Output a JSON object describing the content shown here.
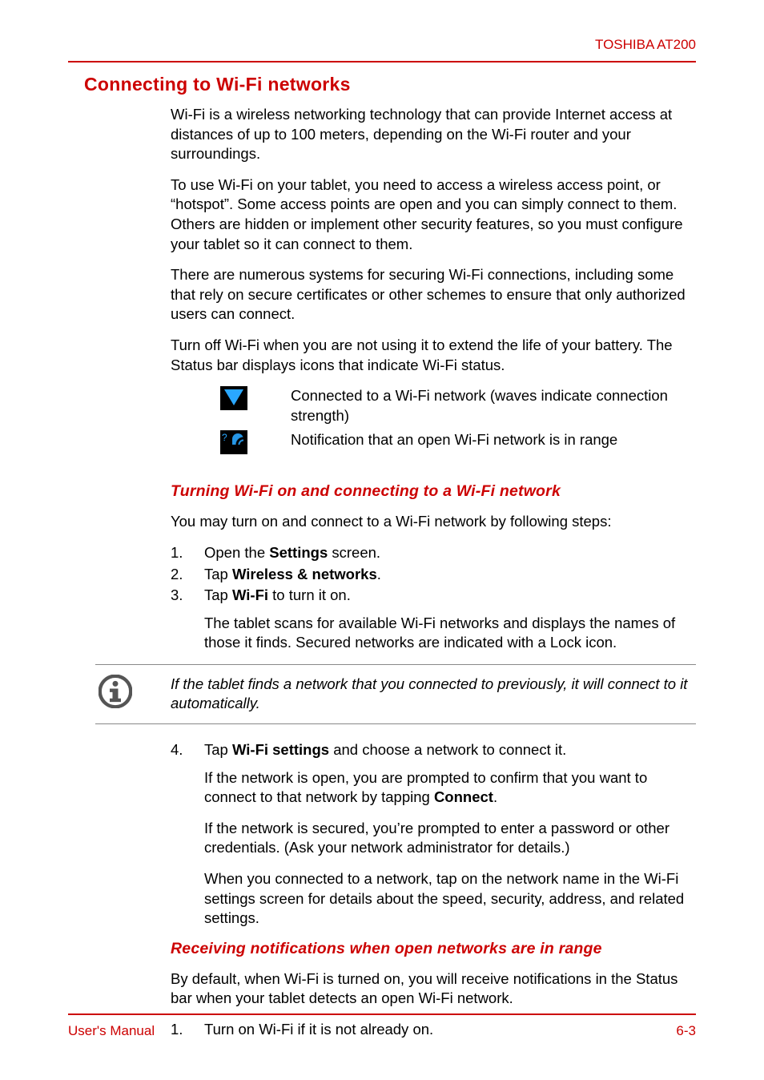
{
  "header": {
    "brand": "TOSHIBA AT200"
  },
  "section": {
    "title": "Connecting to Wi-Fi networks",
    "paras": [
      "Wi-Fi is a wireless networking technology that can provide Internet access at distances of up to 100 meters, depending on the Wi-Fi router and your surroundings.",
      "To use Wi-Fi on your tablet, you need to access a wireless access point, or “hotspot”. Some access points are open and you can simply connect to them. Others are hidden or implement other security features, so you must configure your tablet so it can connect to them.",
      "There are numerous systems for securing Wi-Fi connections, including some that rely on secure certificates or other schemes to ensure that only authorized users can connect.",
      "Turn off Wi-Fi when you are not using it to extend the life of your battery. The Status bar displays icons that indicate Wi-Fi status."
    ],
    "status_icons": [
      {
        "name": "wifi-connected-icon",
        "desc": "Connected to a Wi-Fi network (waves indicate connection strength)"
      },
      {
        "name": "open-wifi-available-icon",
        "desc": "Notification that an open Wi-Fi network is in range"
      }
    ]
  },
  "sub1": {
    "title": "Turning Wi-Fi on and connecting to a Wi-Fi network",
    "intro": "You may turn on and connect to a Wi-Fi network by following steps:",
    "steps_a": [
      {
        "num": "1.",
        "pre": "Open the ",
        "bold": "Settings",
        "post": " screen."
      },
      {
        "num": "2.",
        "pre": "Tap ",
        "bold": "Wireless & networks",
        "post": "."
      },
      {
        "num": "3.",
        "pre": "Tap ",
        "bold": "Wi-Fi",
        "post": " to turn it on."
      }
    ],
    "step3_sub": "The tablet scans for available Wi-Fi networks and displays the names of those it finds. Secured networks are indicated with a Lock icon.",
    "note": "If the tablet finds a network that you connected to previously, it will connect to it automatically.",
    "step4": {
      "num": "4.",
      "pre": "Tap ",
      "bold": "Wi-Fi settings",
      "post": " and choose a network to connect it."
    },
    "step4_subs": [
      {
        "pre": "If the network is open, you are prompted to confirm that you want to connect to that network by tapping ",
        "bold": "Connect",
        "post": "."
      },
      {
        "text": "If the network is secured, you’re prompted to enter a password or other credentials. (Ask your network administrator for details.)"
      },
      {
        "text": "When you connected to a network, tap on the network name in the Wi-Fi settings screen for details about the speed, security, address, and related settings."
      }
    ]
  },
  "sub2": {
    "title": "Receiving notifications when open networks are in range",
    "intro": "By default, when Wi-Fi is turned on, you will receive notifications in the Status bar when your tablet detects an open Wi-Fi network.",
    "steps": [
      {
        "num": "1.",
        "text": "Turn on Wi-Fi if it is not already on."
      }
    ]
  },
  "footer": {
    "left": "User's Manual",
    "right": "6-3"
  }
}
